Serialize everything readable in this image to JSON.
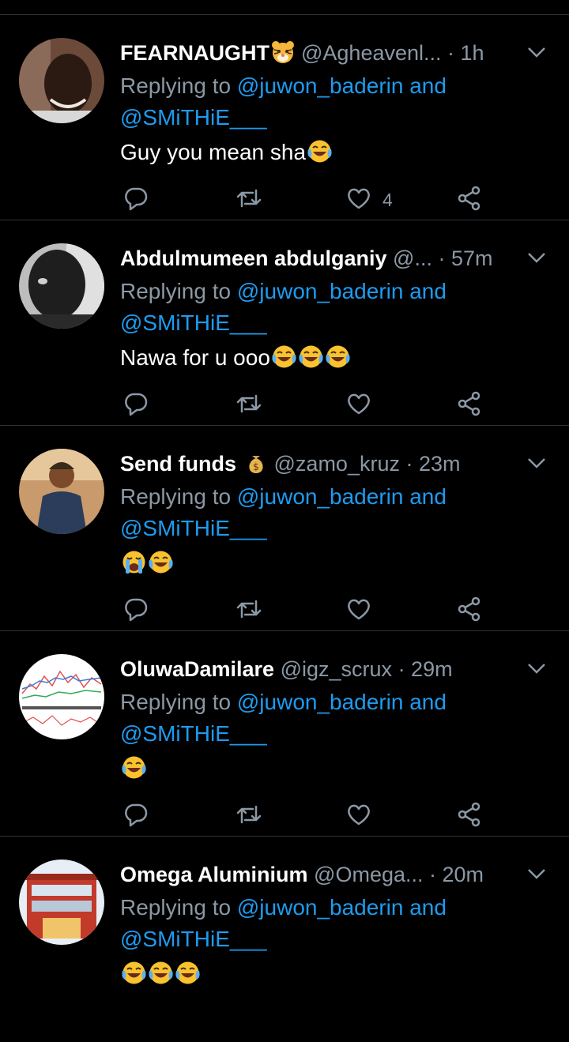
{
  "colors": {
    "background": "#000000",
    "name": "#ffffff",
    "muted": "#8b98a5",
    "mention": "#1d9bf0",
    "divider": "#2f3336"
  },
  "reply_prefix": "Replying to",
  "tweets": [
    {
      "name": "FEARNAUGHT",
      "badge_icon": "tiger-face-icon",
      "handle": "@Agheavenl...",
      "time": "· 1h",
      "mention_1": "@juwon_baderin and",
      "mention_2": "@SMiTHiE___",
      "text": "Guy you mean sha",
      "emojis": [
        "joy-emoji"
      ],
      "like_count": "4"
    },
    {
      "name": "Abdulmumeen abdulganiy",
      "badge_icon": "",
      "handle": "@...",
      "time": "· 57m",
      "mention_1": "@juwon_baderin and",
      "mention_2": "@SMiTHiE___",
      "text": "Nawa for u ooo",
      "emojis": [
        "joy-emoji",
        "joy-emoji",
        "joy-emoji"
      ],
      "like_count": ""
    },
    {
      "name": "Send funds",
      "badge_icon": "money-bag-icon",
      "handle": "@zamo_kruz",
      "time": "· 23m",
      "mention_1": "@juwon_baderin and",
      "mention_2": "@SMiTHiE___",
      "text": "",
      "emojis": [
        "loudly-crying-emoji",
        "joy-emoji"
      ],
      "like_count": ""
    },
    {
      "name": "OluwaDamilare",
      "badge_icon": "",
      "handle": "@igz_scrux",
      "time": "· 29m",
      "mention_1": "@juwon_baderin and",
      "mention_2": "@SMiTHiE___",
      "text": "",
      "emojis": [
        "joy-emoji"
      ],
      "like_count": ""
    },
    {
      "name": "Omega Aluminium",
      "badge_icon": "",
      "handle": "@Omega...",
      "time": "· 20m",
      "mention_1": "@juwon_baderin and",
      "mention_2": "@SMiTHiE___",
      "text": "",
      "emojis": [
        "joy-emoji",
        "joy-emoji",
        "joy-emoji"
      ],
      "like_count": ""
    }
  ]
}
